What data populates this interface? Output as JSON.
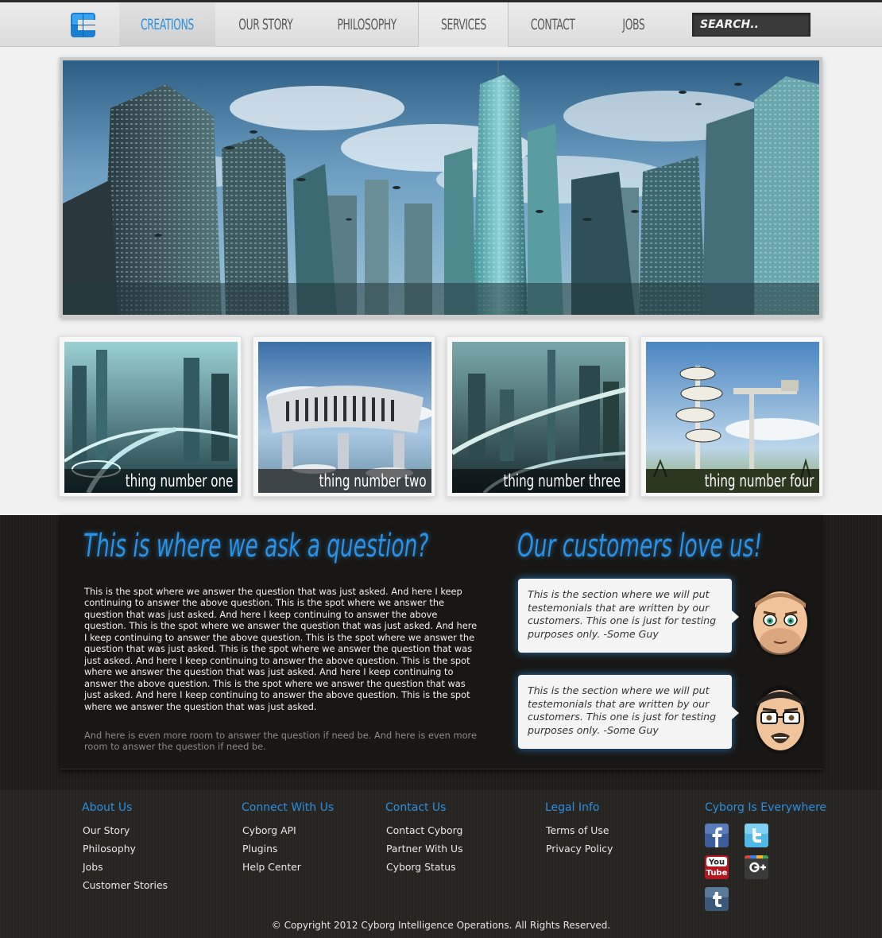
{
  "nav": {
    "items": [
      {
        "label": "Creations"
      },
      {
        "label": "Our Story"
      },
      {
        "label": "Philosophy"
      },
      {
        "label": "Services"
      },
      {
        "label": "Contact"
      },
      {
        "label": "Jobs"
      }
    ],
    "search_placeholder": "SEARCH.."
  },
  "thumbs": [
    {
      "caption": "thing number one"
    },
    {
      "caption": "thing number two"
    },
    {
      "caption": "thing number three"
    },
    {
      "caption": "thing number four"
    }
  ],
  "question": {
    "heading": "This is where we ask a question?",
    "answer": "This is the spot where we answer the question that was just asked. And here I keep continuing to answer the above question. This is the spot where we answer the question that was just asked. And here I keep continuing to answer the above question. This is the spot where we answer the question that was just asked. And here I keep continuing to answer the above question. This is the spot where we answer the question that was just asked. This is the spot where we answer the question that was just asked. And here I keep continuing to answer the above question. This is the spot where we answer the question that was just asked. And here I keep continuing to answer the above question. This is the spot where we answer the question that was just asked. And here I keep continuing to answer the above question. This is the spot where we answer the question that was just asked.",
    "more": "And here is even more room to answer the question if need be. And here is even more room to answer the question if need be."
  },
  "testimonials": {
    "heading": "Our customers love us!",
    "items": [
      {
        "text": "This is the section where we will put testemonials that are written by our customers. This one is just for testing purposes only.    -Some Guy"
      },
      {
        "text": "This is the section where we will put testemonials that are written by our customers. This one is just for testing purposes only.    -Some Guy"
      }
    ]
  },
  "footer": {
    "columns": [
      {
        "title": "About Us",
        "links": [
          "Our Story",
          "Philosophy",
          "Jobs",
          "Customer Stories"
        ]
      },
      {
        "title": "Connect With Us",
        "links": [
          "Cyborg API",
          "Plugins",
          "Help Center"
        ]
      },
      {
        "title": "Contact Us",
        "links": [
          "Contact Cyborg",
          "Partner With Us",
          "Cyborg Status"
        ]
      },
      {
        "title": "Legal Info",
        "links": [
          "Terms of Use",
          "Privacy Policy"
        ]
      }
    ],
    "social_title": "Cyborg Is Everywhere",
    "social_icons": [
      "facebook-icon",
      "twitter-icon",
      "youtube-icon",
      "google-plus-icon",
      "tumblr-icon"
    ],
    "youtube_label_top": "You",
    "youtube_label_bottom": "Tube",
    "copyright": "© Copyright 2012 Cyborg Intelligence Operations. All Rights Reserved."
  },
  "colors": {
    "accent": "#2a92e6",
    "dark_bg": "#1e1d1b",
    "page_bg": "#f1f1f1"
  }
}
